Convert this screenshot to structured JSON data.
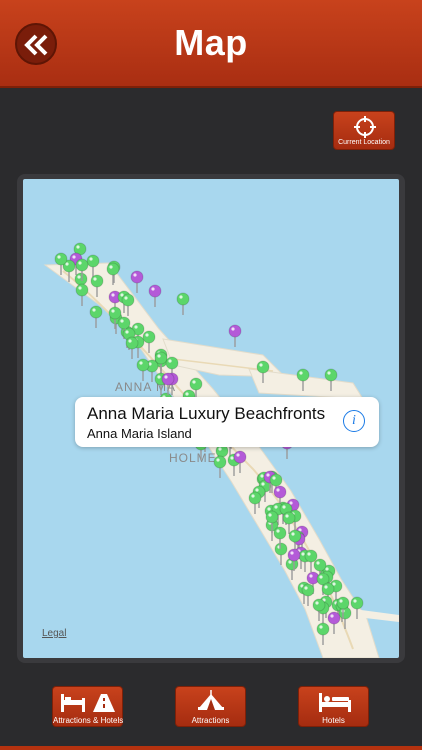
{
  "header": {
    "title": "Map"
  },
  "toolbar": {
    "current_location_label": "Current Location"
  },
  "map": {
    "area_labels": [
      "ANNA MA",
      "HOLMES"
    ],
    "callout": {
      "title": "Anna Maria Luxury Beachfronts",
      "subtitle": "Anna Maria Island"
    },
    "legal_label": "Legal",
    "pin_colors": {
      "attraction": "#5cd66a",
      "hotel": "#b45ad8"
    }
  },
  "tabs": [
    {
      "label": "Attractions & Hotels",
      "icon": "bed-road-icon"
    },
    {
      "label": "Attractions",
      "icon": "tent-icon"
    },
    {
      "label": "Hotels",
      "icon": "bed-icon"
    }
  ],
  "colors": {
    "accent": "#b5320f",
    "background": "#2b2b2d",
    "water": "#a8d7ee",
    "land": "#f4efe3"
  }
}
